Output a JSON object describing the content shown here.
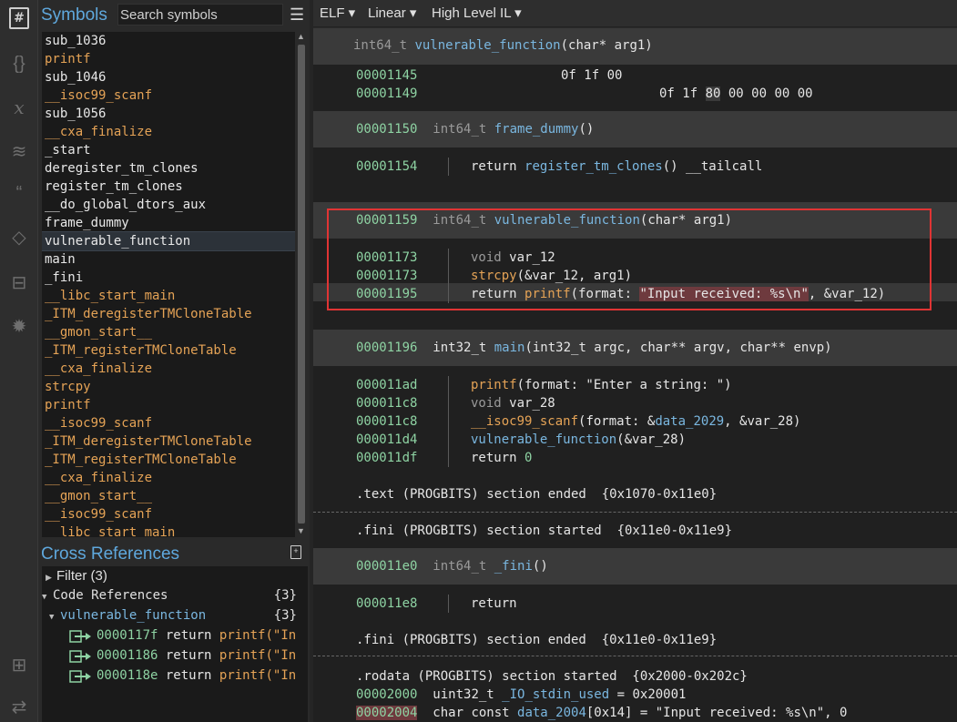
{
  "symbols_panel": {
    "title": "Symbols",
    "search_placeholder": "Search symbols",
    "menu_icon": "hamburger-icon",
    "items": [
      {
        "name": "sub_1036",
        "kind": "local"
      },
      {
        "name": "printf",
        "kind": "import"
      },
      {
        "name": "sub_1046",
        "kind": "local"
      },
      {
        "name": "__isoc99_scanf",
        "kind": "import"
      },
      {
        "name": "sub_1056",
        "kind": "local"
      },
      {
        "name": "__cxa_finalize",
        "kind": "import"
      },
      {
        "name": "_start",
        "kind": "local"
      },
      {
        "name": "deregister_tm_clones",
        "kind": "local"
      },
      {
        "name": "register_tm_clones",
        "kind": "local"
      },
      {
        "name": "__do_global_dtors_aux",
        "kind": "local"
      },
      {
        "name": "frame_dummy",
        "kind": "local"
      },
      {
        "name": "vulnerable_function",
        "kind": "local",
        "selected": true
      },
      {
        "name": "main",
        "kind": "local"
      },
      {
        "name": "_fini",
        "kind": "local"
      },
      {
        "name": "__libc_start_main",
        "kind": "import"
      },
      {
        "name": "_ITM_deregisterTMCloneTable",
        "kind": "import"
      },
      {
        "name": "__gmon_start__",
        "kind": "import"
      },
      {
        "name": "_ITM_registerTMCloneTable",
        "kind": "import"
      },
      {
        "name": "__cxa_finalize",
        "kind": "import"
      },
      {
        "name": "strcpy",
        "kind": "import"
      },
      {
        "name": "printf",
        "kind": "import"
      },
      {
        "name": "__isoc99_scanf",
        "kind": "import"
      },
      {
        "name": "_ITM_deregisterTMCloneTable",
        "kind": "import"
      },
      {
        "name": "_ITM_registerTMCloneTable",
        "kind": "import"
      },
      {
        "name": "__cxa_finalize",
        "kind": "import"
      },
      {
        "name": "__gmon_start__",
        "kind": "import"
      },
      {
        "name": "__isoc99_scanf",
        "kind": "import"
      },
      {
        "name": "__libc_start_main",
        "kind": "import"
      }
    ]
  },
  "xrefs_panel": {
    "title": "Cross References",
    "filter_label": "Filter (3)",
    "code_refs_label": "Code References",
    "code_refs_count": "{3}",
    "function_label": "vulnerable_function",
    "function_count": "{3}",
    "refs": [
      {
        "addr": "0000117f",
        "kw": "return",
        "text": "printf(\"In"
      },
      {
        "addr": "00001186",
        "kw": "return",
        "text": "printf(\"In"
      },
      {
        "addr": "0000118e",
        "kw": "return",
        "text": "printf(\"In"
      }
    ]
  },
  "toolbar": {
    "view_type": "ELF ▾",
    "layout": "Linear ▾",
    "il_level": "High Level IL ▾"
  },
  "code": {
    "top_header": {
      "type": "int64_t ",
      "name": "vulnerable_function",
      "args": "(char* arg1)"
    },
    "bytes1_addr": "00001145",
    "bytes1": "0f 1f 00",
    "bytes2_addr": "00001149",
    "bytes2_pre": "0f 1f ",
    "bytes2_hl": "80",
    "bytes2_post": " 00 00 00 00",
    "fd_header_addr": "00001150",
    "fd_type": "int64_t ",
    "fd_name": "frame_dummy",
    "fd_args": "()",
    "fd_line_addr": "00001154",
    "fd_kw": "return ",
    "fd_call": "register_tm_clones",
    "fd_rest": "() __tailcall",
    "vf_header_addr": "00001159",
    "vf_type": "int64_t ",
    "vf_name": "vulnerable_function",
    "vf_args": "(char* arg1)",
    "vf_l1_addr": "00001173",
    "vf_l1_kw": "void ",
    "vf_l1_rest": "var_12",
    "vf_l2_addr": "00001173",
    "vf_l2_call": "strcpy",
    "vf_l2_rest": "(&var_12, arg1)",
    "vf_l3_addr": "00001195",
    "vf_l3_kw": "return ",
    "vf_l3_call": "printf",
    "vf_l3_mid": "(format: ",
    "vf_l3_str": "\"Input received: %s\\n\"",
    "vf_l3_end": ", &var_12)",
    "main_header_addr": "00001196",
    "main_type": "int32_t ",
    "main_name": "main",
    "main_args": "(int32_t argc, char** argv, char** envp)",
    "m1_addr": "000011ad",
    "m1_call": "printf",
    "m1_rest": "(format: \"Enter a string: \")",
    "m2_addr": "000011c8",
    "m2_kw": "void ",
    "m2_rest": "var_28",
    "m3_addr": "000011c8",
    "m3_call": "__isoc99_scanf",
    "m3_mid": "(format: &",
    "m3_data": "data_2029",
    "m3_end": ", &var_28)",
    "m4_addr": "000011d4",
    "m4_call": "vulnerable_function",
    "m4_rest": "(&var_28)",
    "m5_addr": "000011df",
    "m5_kw": "return ",
    "m5_rest": "0",
    "text_end": ".text (PROGBITS) section ended  {0x1070-0x11e0}",
    "fini_start": ".fini (PROGBITS) section started  {0x11e0-0x11e9}",
    "fini_header_addr": "000011e0",
    "fini_type": "int64_t ",
    "fini_name": "_fini",
    "fini_args": "()",
    "fini_l1_addr": "000011e8",
    "fini_l1_kw": "return",
    "fini_end": ".fini (PROGBITS) section ended  {0x11e0-0x11e9}",
    "rodata_start": ".rodata (PROGBITS) section started  {0x2000-0x202c}",
    "ro1_addr": "00002000",
    "ro1_type": "uint32_t ",
    "ro1_name": "_IO_stdin_used",
    "ro1_rest": " = 0x20001",
    "ro2_addr": "00002004",
    "ro2_type": "char const ",
    "ro2_name": "data_2004",
    "ro2_rest": "[0x14] = \"Input received: %s\\n\", 0"
  },
  "colors": {
    "accent": "#5fa8dd",
    "address": "#8ed3a3",
    "import": "#e5a356",
    "highlight_box": "#e03434"
  }
}
